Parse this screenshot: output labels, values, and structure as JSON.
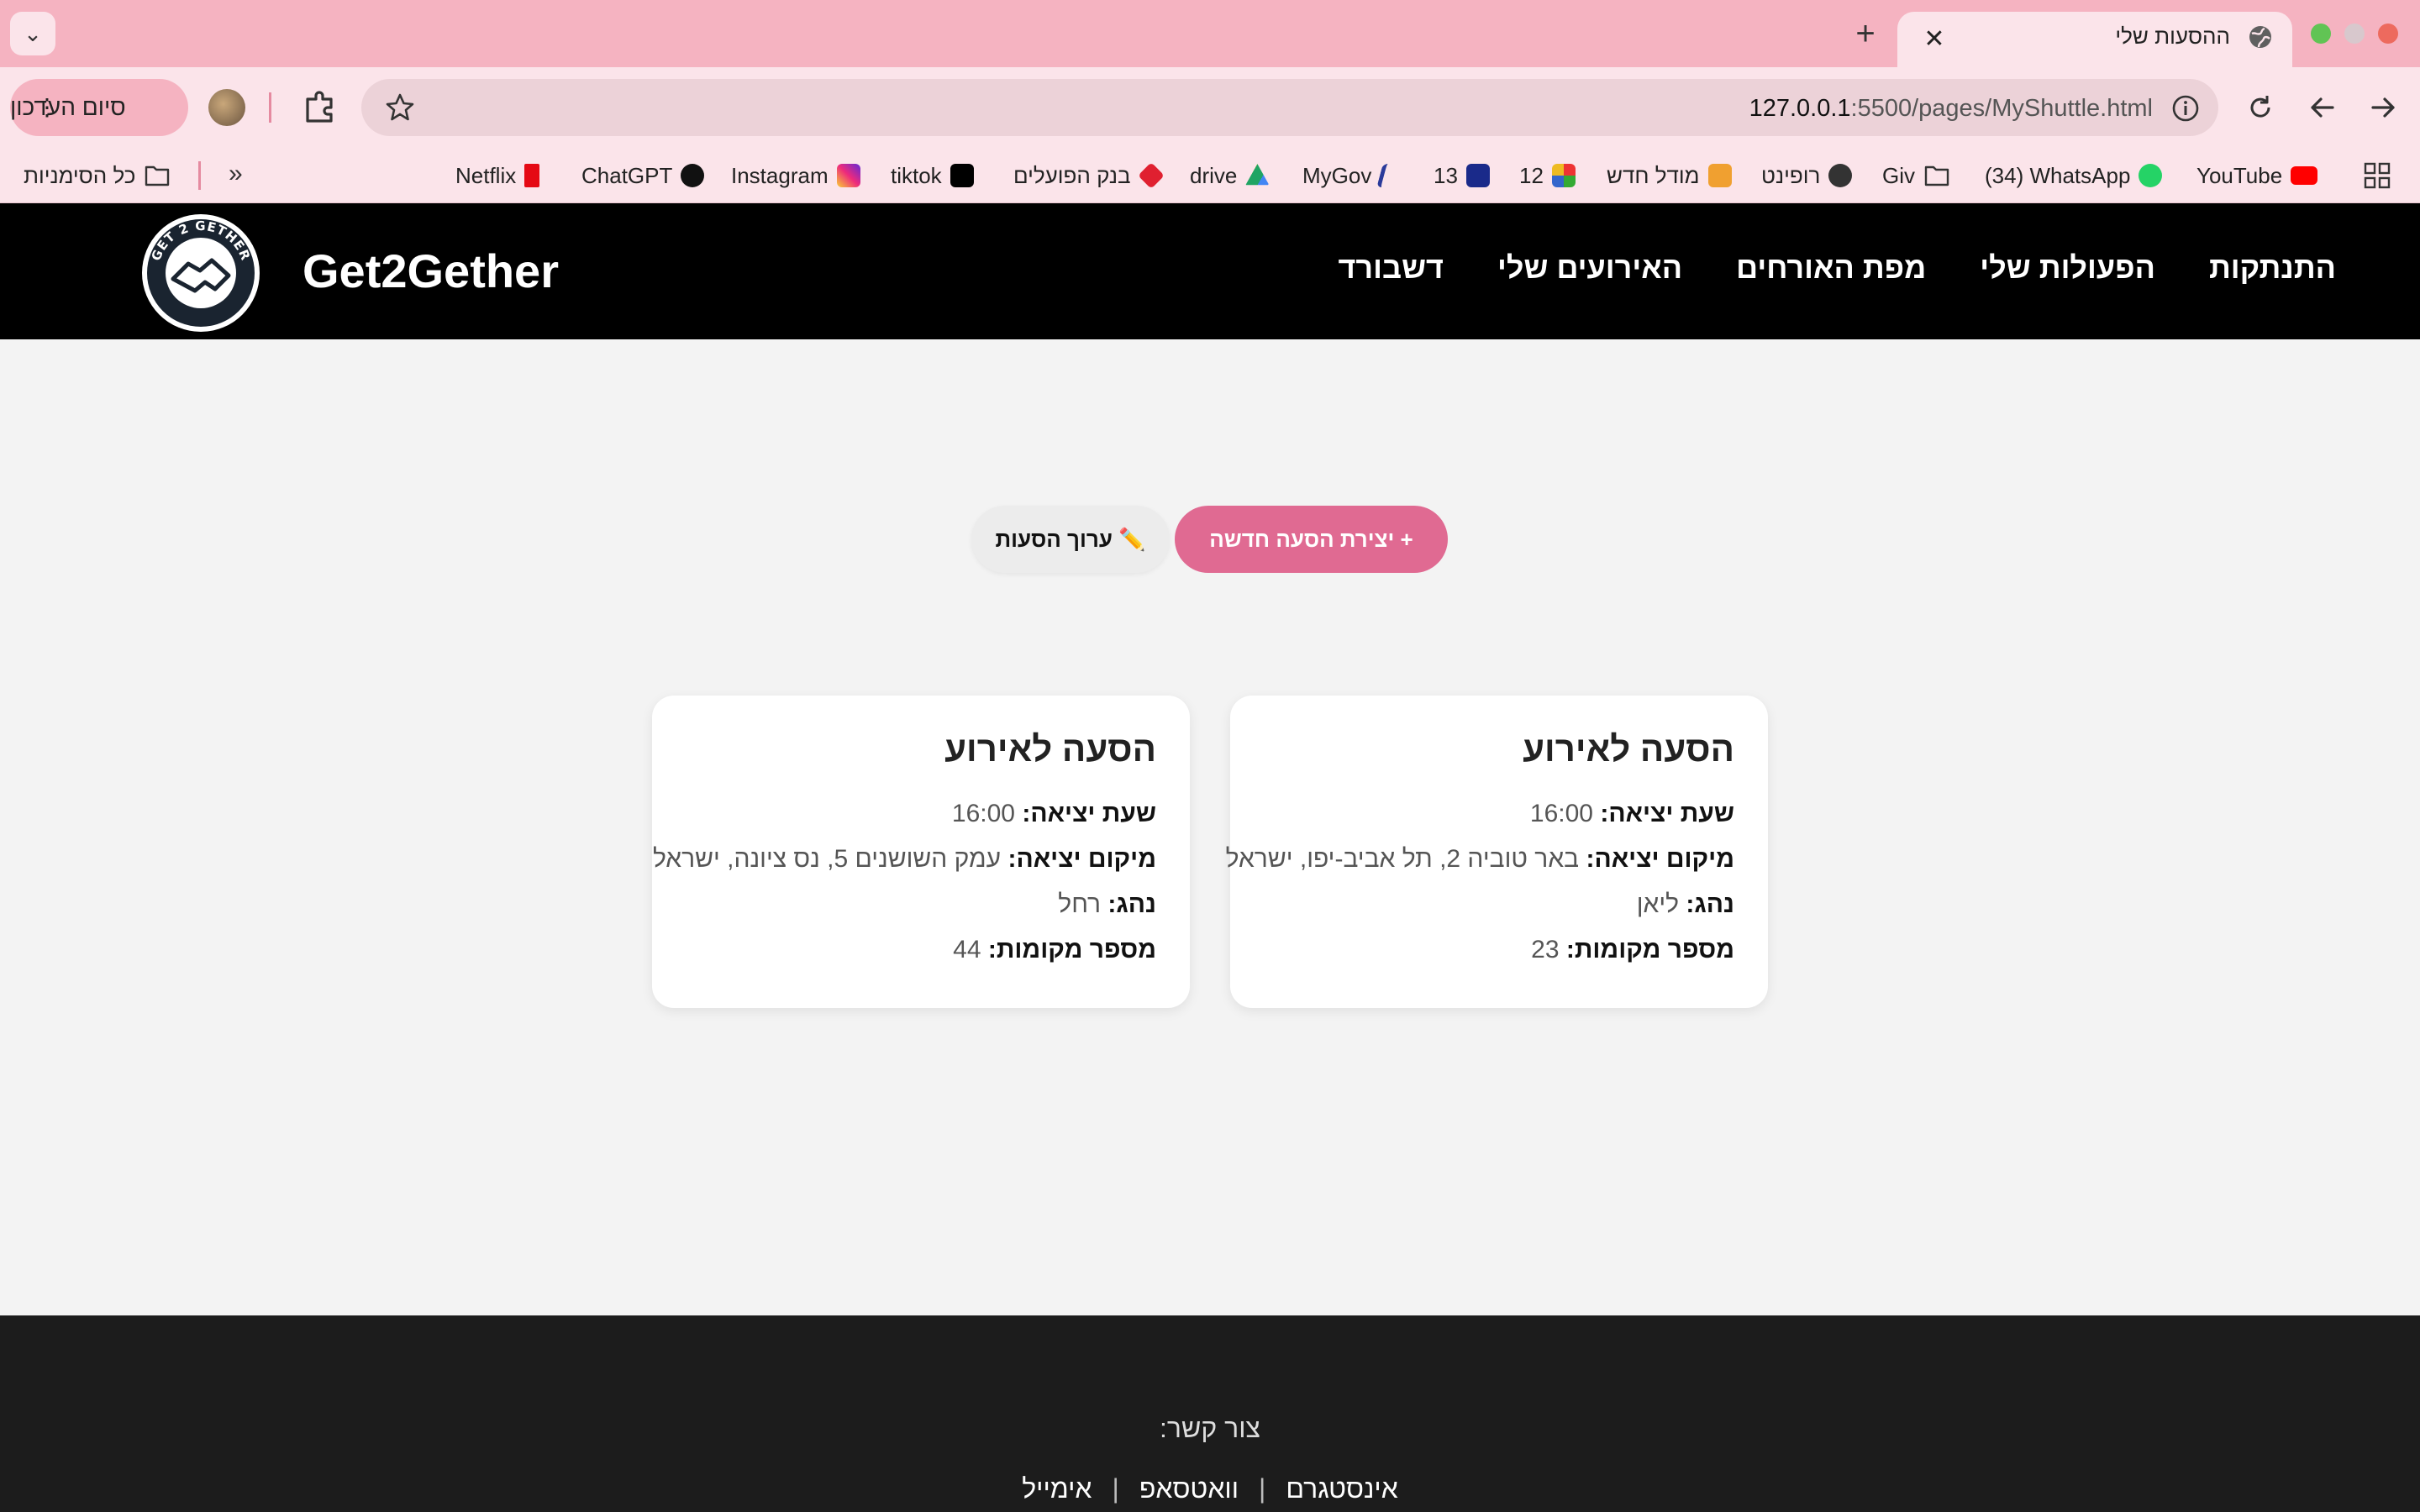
{
  "browser": {
    "tab_title": "ההסעות שלי",
    "new_tab_symbol": "+",
    "close_symbol": "✕",
    "menu_symbol": "⌄",
    "finish_update_label": "סיום העדכון",
    "url_host": "127.0.0.1",
    "url_path": ":5500/pages/MyShuttle.html",
    "more_symbol": "»",
    "bookmarks": [
      {
        "label": "YouTube",
        "color": "#ff0000"
      },
      {
        "label": "(34) WhatsApp",
        "color": "#25d366"
      },
      {
        "label": "Giv",
        "color": "#888888"
      },
      {
        "label": "רופינט",
        "color": "#333333"
      },
      {
        "label": "מודל חדש",
        "color": "#f0a030"
      },
      {
        "label": "12",
        "color": "#e0a020"
      },
      {
        "label": "13",
        "color": "#1a2a8a"
      },
      {
        "label": "MyGov",
        "color": "#2a3a9a"
      },
      {
        "label": "drive",
        "color": "#1fa463"
      },
      {
        "label": "בנק הפועלים",
        "color": "#e02030"
      },
      {
        "label": "tiktok",
        "color": "#000000"
      },
      {
        "label": "Instagram",
        "color": "#e1306c"
      },
      {
        "label": "ChatGPT",
        "color": "#111111"
      },
      {
        "label": "Netflix",
        "color": "#e50914"
      }
    ],
    "all_bookmarks_label": "כל הסימניות"
  },
  "site": {
    "title": "Get2Gether",
    "logo_text": "GET 2 GETHER",
    "nav": [
      "דשבורד",
      "האירועים שלי",
      "מפת האורחים",
      "הפעולות שלי",
      "התנתקות"
    ]
  },
  "actions": {
    "create_label": "+ יצירת הסעה חדשה",
    "edit_label": "✏️ ערוך הסעות"
  },
  "cards": [
    {
      "title": "הסעה לאירוע",
      "departure_time_label": "שעת יציאה:",
      "departure_time": "16:00",
      "location_label": "מיקום יציאה:",
      "location": "באר טוביה 2, תל אביב-יפו, ישראל",
      "driver_label": "נהג:",
      "driver": "ליאן",
      "seats_label": "מספר מקומות:",
      "seats": "23"
    },
    {
      "title": "הסעה לאירוע",
      "departure_time_label": "שעת יציאה:",
      "departure_time": "16:00",
      "location_label": "מיקום יציאה:",
      "location": "עמק השושנים 5, נס ציונה, ישראל",
      "driver_label": "נהג:",
      "driver": "רחל",
      "seats_label": "מספר מקומות:",
      "seats": "44"
    }
  ],
  "footer": {
    "contact_label": "צור קשר:",
    "links": [
      "אינסטגרם",
      "וואטסאפ",
      "אימייל"
    ],
    "separator": "|"
  },
  "colors": {
    "accent_pink": "#e06a92",
    "header_bg": "#000000",
    "footer_bg": "#1c1c1c",
    "chrome_pink": "#f5b3c1"
  }
}
